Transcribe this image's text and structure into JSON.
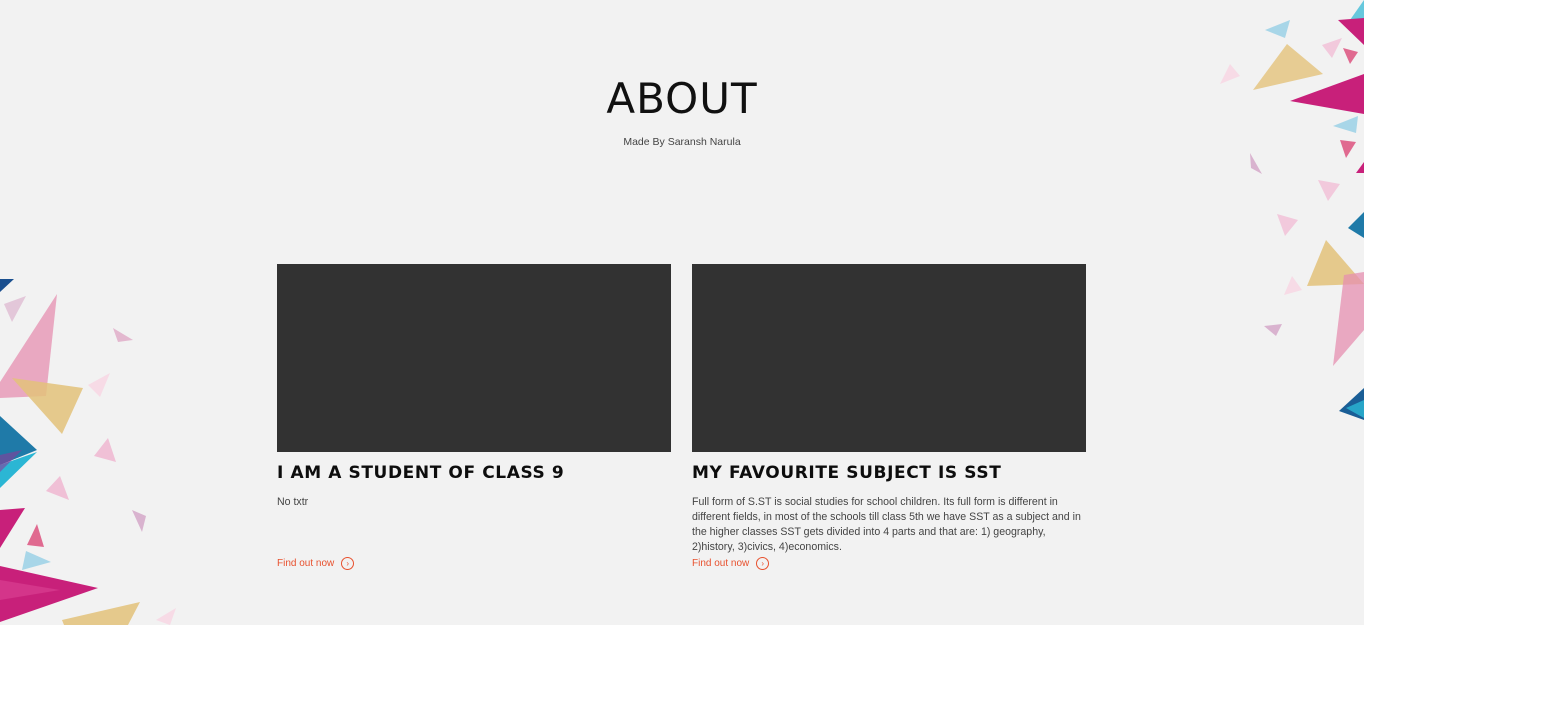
{
  "about": {
    "title": "ABOUT",
    "subtitle": "Made By Saransh Narula"
  },
  "cards": [
    {
      "title": "I AM A STUDENT OF CLASS 9",
      "text": "No txtr",
      "link_label": "Find out now",
      "link_icon": "circle-arrow-right-icon"
    },
    {
      "title": "MY FAVOURITE SUBJECT IS SST",
      "text": "Full form of S.ST is social studies for school children. Its full form is different in different fields, in most of the schools till class 5th we have SST as a subject and in the higher classes SST gets divided into 4 parts and that are: 1) geography, 2)history, 3)civics, 4)economics.",
      "link_label": "Find out now",
      "link_icon": "circle-arrow-right-icon"
    }
  ],
  "colors": {
    "section_bg": "#f2f2f2",
    "card_image_bg": "#323232",
    "link": "#e8512e",
    "magenta": "#c8207a",
    "pink": "#e68fb0",
    "gold": "#e3c27a",
    "blue": "#1f7aa8",
    "cyan": "#2bb6d4",
    "light_blue": "#a8d6e8",
    "lilac": "#d9b3cf"
  }
}
